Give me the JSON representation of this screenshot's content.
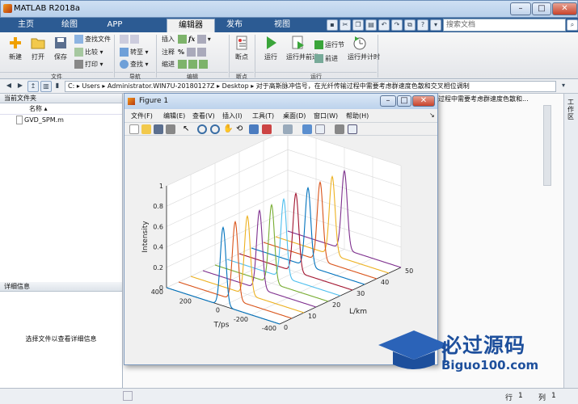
{
  "window": {
    "title": "MATLAB R2018a",
    "min": "–",
    "max": "□",
    "close": "✕"
  },
  "tabs": [
    {
      "label": "主页"
    },
    {
      "label": "绘图"
    },
    {
      "label": "APP"
    },
    {
      "label": "编辑器"
    },
    {
      "label": "发布"
    },
    {
      "label": "视图"
    }
  ],
  "search": {
    "placeholder": "搜索文档"
  },
  "ribbon": {
    "file": {
      "new": "新建",
      "open": "打开",
      "save": "保存",
      "find_files": "查找文件",
      "compare": "比较",
      "print": "打印",
      "group": "文件"
    },
    "navigate": {
      "goto": "转至",
      "find": "查找",
      "group": "导航"
    },
    "edit": {
      "insert": "插入",
      "fx": "fx",
      "comment": "注释",
      "comment_sym": "%",
      "indent": "缩进",
      "group": "编辑"
    },
    "breakpoints": {
      "label": "断点",
      "group": "断点"
    },
    "run": {
      "run": "运行",
      "run_advance": "运行并前进",
      "run_section": "运行节",
      "advance": "前进",
      "run_time": "运行并计时",
      "group": "运行"
    }
  },
  "address": {
    "segments": [
      "C:",
      "Users",
      "Administrator.WIN7U-20180127Z",
      "Desktop",
      "对于高斯脉冲信号，在光纤传输过程中需要考虑群速度色散和交叉相位调制"
    ]
  },
  "current_folder": {
    "title": "当前文件夹",
    "column": "名称",
    "files": [
      {
        "name": "GVD_SPM.m"
      }
    ]
  },
  "editor_tab": {
    "label": "过程中需要考虑群速度色散和..."
  },
  "details": {
    "title": "详细信息",
    "message": "选择文件以查看详细信息"
  },
  "right_strip": {
    "label": "工作区"
  },
  "status": {
    "row_label": "行",
    "row": "1",
    "col_label": "列",
    "col": "1"
  },
  "figure": {
    "title": "Figure 1",
    "menu": [
      "文件(F)",
      "编辑(E)",
      "查看(V)",
      "插入(I)",
      "工具(T)",
      "桌面(D)",
      "窗口(W)",
      "帮助(H)"
    ]
  },
  "chart_data": {
    "type": "line",
    "title": "",
    "xlabel": "T/ps",
    "ylabel": "L/km",
    "zlabel": "Intensity",
    "x_ticks": [
      -400,
      -200,
      0,
      200,
      400
    ],
    "y_ticks": [
      0,
      10,
      20,
      30,
      40,
      50
    ],
    "z_ticks": [
      0,
      0.2,
      0.4,
      0.6,
      0.8,
      1
    ],
    "xlim": [
      -400,
      400
    ],
    "ylim": [
      0,
      50
    ],
    "zlim": [
      0,
      1
    ],
    "grid": true,
    "series": [
      {
        "y": 0,
        "peak_t": 0,
        "width_ps": 20,
        "amplitude": 0.77,
        "color": "#0072bd"
      },
      {
        "y": 5,
        "peak_t": 0,
        "width_ps": 20,
        "amplitude": 0.77,
        "color": "#d95319"
      },
      {
        "y": 10,
        "peak_t": 0,
        "width_ps": 20,
        "amplitude": 0.77,
        "color": "#edb120"
      },
      {
        "y": 15,
        "peak_t": 0,
        "width_ps": 20,
        "amplitude": 0.77,
        "color": "#7e2f8e"
      },
      {
        "y": 20,
        "peak_t": 0,
        "width_ps": 20,
        "amplitude": 0.77,
        "color": "#77ac30"
      },
      {
        "y": 25,
        "peak_t": 0,
        "width_ps": 20,
        "amplitude": 0.77,
        "color": "#4dbeee"
      },
      {
        "y": 30,
        "peak_t": 0,
        "width_ps": 20,
        "amplitude": 0.77,
        "color": "#a2142f"
      },
      {
        "y": 35,
        "peak_t": 0,
        "width_ps": 20,
        "amplitude": 0.77,
        "color": "#0072bd"
      },
      {
        "y": 40,
        "peak_t": 0,
        "width_ps": 20,
        "amplitude": 0.77,
        "color": "#d95319"
      },
      {
        "y": 45,
        "peak_t": 0,
        "width_ps": 20,
        "amplitude": 0.77,
        "color": "#edb120"
      },
      {
        "y": 50,
        "peak_t": 0,
        "width_ps": 20,
        "amplitude": 0.77,
        "color": "#7e2f8e"
      }
    ]
  },
  "watermark": {
    "cn": "必过源码",
    "en": "Biguo100.com"
  }
}
